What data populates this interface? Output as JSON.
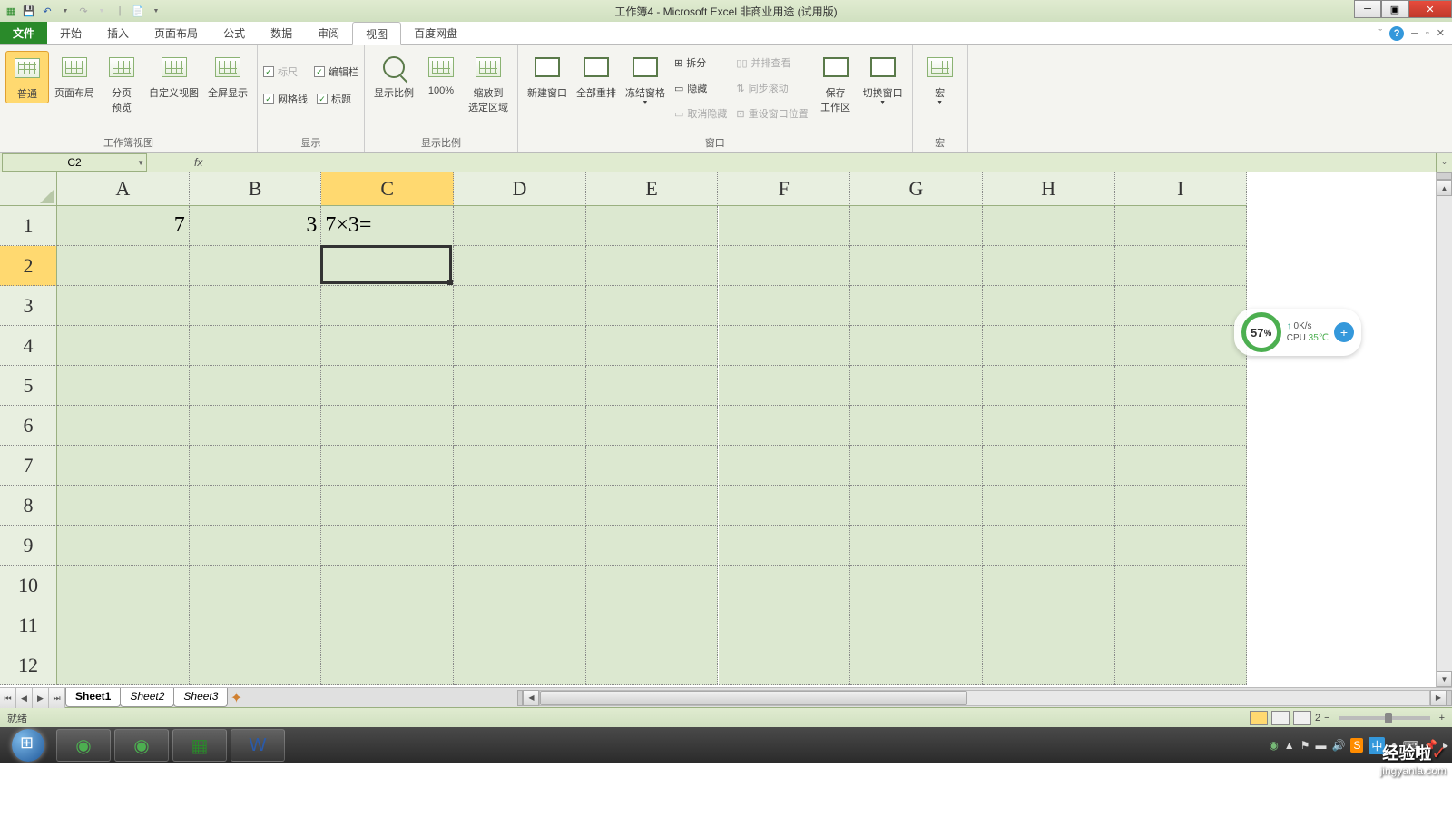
{
  "title": "工作簿4 - Microsoft Excel 非商业用途 (试用版)",
  "tabs": {
    "file": "文件",
    "items": [
      "开始",
      "插入",
      "页面布局",
      "公式",
      "数据",
      "审阅",
      "视图",
      "百度网盘"
    ],
    "active": "视图"
  },
  "ribbon": {
    "g1": {
      "label": "工作簿视图",
      "btns": [
        "普通",
        "页面布局",
        "分页\n预览",
        "自定义视图",
        "全屏显示"
      ]
    },
    "g2": {
      "label": "显示",
      "checks": [
        {
          "t": "标尺",
          "on": true,
          "dis": true
        },
        {
          "t": "编辑栏",
          "on": true
        },
        {
          "t": "网格线",
          "on": true
        },
        {
          "t": "标题",
          "on": true
        }
      ]
    },
    "g3": {
      "label": "显示比例",
      "btns": [
        "显示比例",
        "100%",
        "缩放到\n选定区域"
      ]
    },
    "g4": {
      "label": "窗口",
      "big": [
        "新建窗口",
        "全部重排",
        "冻结窗格"
      ],
      "small": [
        "拆分",
        "隐藏",
        "取消隐藏"
      ],
      "small2": [
        "并排查看",
        "同步滚动",
        "重设窗口位置"
      ],
      "end": [
        "保存\n工作区",
        "切换窗口"
      ]
    },
    "g5": {
      "label": "宏",
      "btn": "宏"
    }
  },
  "namebox": "C2",
  "fx": "fx",
  "formula": "",
  "cols": [
    "A",
    "B",
    "C",
    "D",
    "E",
    "F",
    "G",
    "H",
    "I"
  ],
  "rows": [
    "1",
    "2",
    "3",
    "4",
    "5",
    "6",
    "7",
    "8",
    "9",
    "10",
    "11",
    "12"
  ],
  "selCol": "C",
  "selRow": "2",
  "cells": {
    "A1": "7",
    "B1": "3",
    "C1": "7×3="
  },
  "sheets": [
    "Sheet1",
    "Sheet2",
    "Sheet3"
  ],
  "activeSheet": "Sheet1",
  "status": "就绪",
  "zoom": "2",
  "float": {
    "pct": "57",
    "pctUnit": "％",
    "net": "0K/s",
    "cpu": "CPU",
    "temp": "35℃"
  },
  "watermark": {
    "t1": "经验啦",
    "t2": "jingyanla.com"
  },
  "tray": {
    "ime": "中"
  }
}
